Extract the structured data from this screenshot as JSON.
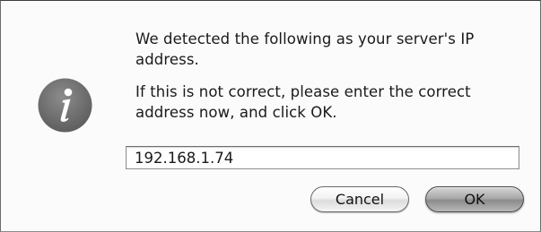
{
  "dialog": {
    "icon": "info-icon",
    "message_line_1": "We detected the following as your server's IP address.",
    "message_line_2": "If this is not correct, please enter the correct address now, and click OK.",
    "ip_value": "192.168.1.74",
    "cancel_label": "Cancel",
    "ok_label": "OK"
  }
}
